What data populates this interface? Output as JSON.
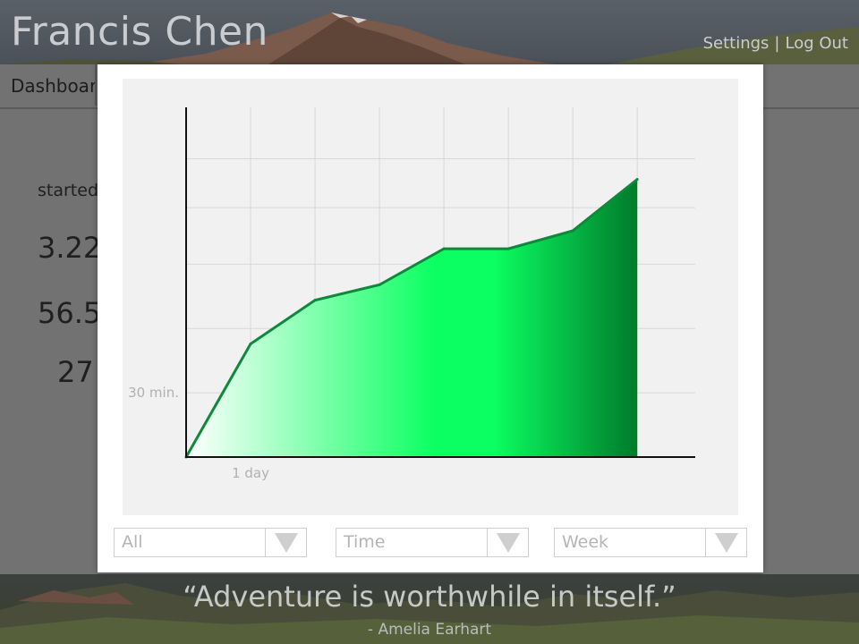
{
  "header": {
    "title": "Francis Chen",
    "links": [
      "Settings",
      "Log Out"
    ],
    "link_separator": "|"
  },
  "subnav": {
    "tab_label": "Dashboard"
  },
  "stats": {
    "label": "started",
    "values": [
      "3.22",
      "56.5",
      "27"
    ]
  },
  "footer": {
    "quote": "“Adventure is worthwhile in itself.”",
    "author": "- Amelia Earhart"
  },
  "modal": {
    "filters": [
      {
        "value": "All"
      },
      {
        "value": "Time"
      },
      {
        "value": "Week"
      }
    ]
  },
  "chart_data": {
    "type": "area",
    "x": [
      0,
      1,
      2,
      3,
      4,
      5,
      6,
      7
    ],
    "values": [
      0,
      44,
      61,
      67,
      81,
      81,
      88,
      108
    ],
    "x_tick_label": "1 day",
    "y_tick_label": "30 min.",
    "xlim": [
      0,
      7.9
    ],
    "ylim": [
      0,
      136
    ],
    "grid": true,
    "colors": {
      "line": "#0b8a3a",
      "fill_start": "#ffffff",
      "fill_mid": "#0bff62",
      "fill_end": "#007a2a",
      "grid": "#d8d8d8",
      "axis": "#111111",
      "tick_text": "#b0b0b0"
    }
  }
}
